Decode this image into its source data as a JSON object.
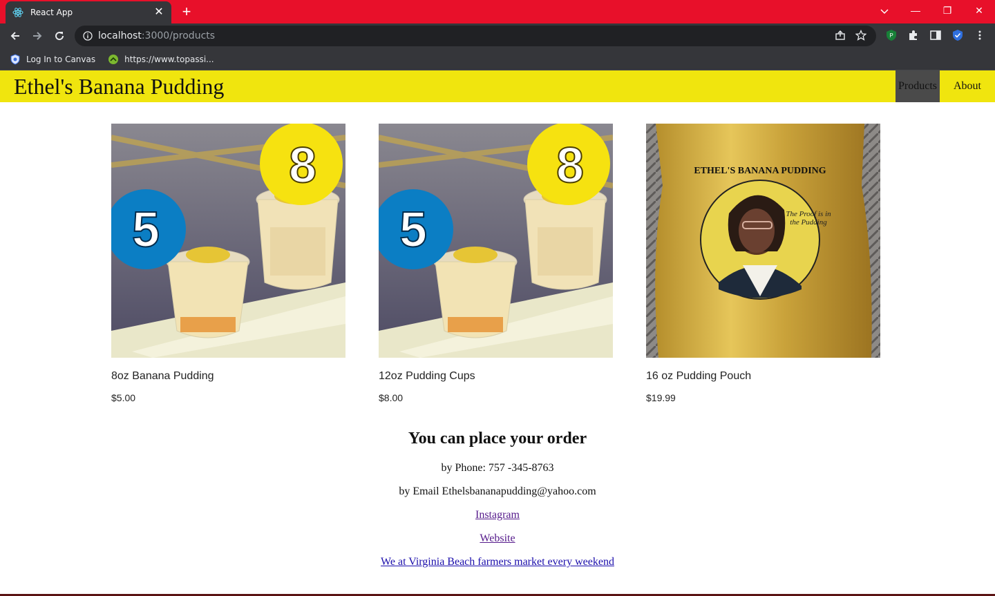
{
  "browser": {
    "tab_title": "React App",
    "url_host": "localhost",
    "url_path": ":3000/products",
    "bookmarks": [
      {
        "label": "Log In to Canvas"
      },
      {
        "label": "https://www.topassi..."
      }
    ]
  },
  "site": {
    "title": "Ethel's Banana Pudding",
    "nav": {
      "products": "Products",
      "about": "About"
    }
  },
  "products": [
    {
      "name": "8oz Banana Pudding",
      "price": "$5.00",
      "badge_left": "5",
      "badge_right": "8"
    },
    {
      "name": "12oz Pudding Cups",
      "price": "$8.00",
      "badge_left": "5",
      "badge_right": "8"
    },
    {
      "name": "16 oz Pudding Pouch",
      "price": "$19.99",
      "label_top": "ETHEL'S BANANA PUDDING",
      "label_tag": "The Proof is in the Pudding"
    }
  ],
  "order": {
    "heading": "You can place your order",
    "phone": "by Phone: 757 -345-8763",
    "email": "by Email Ethelsbananapudding@yahoo.com",
    "instagram": "Instagram",
    "website": "Website",
    "market": "We at Virginia Beach farmers market every weekend"
  },
  "colors": {
    "header": "#f0e50e",
    "tabstrip": "#e8102a",
    "nav_active": "#4a4a4a"
  }
}
